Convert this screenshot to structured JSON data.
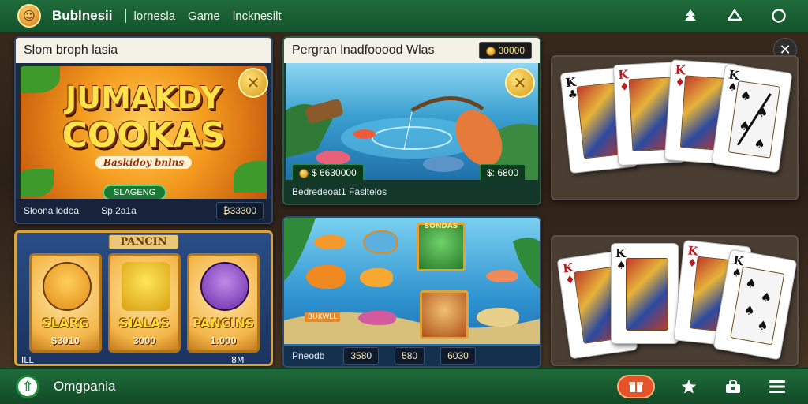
{
  "topbar": {
    "brand": "Bublnesii",
    "nav": [
      "lornesla",
      "Game",
      "lncknesilt"
    ],
    "icons": [
      "tree-icon",
      "home-icon",
      "circle-icon"
    ]
  },
  "card1": {
    "header": "Slom broph lasia",
    "title_line1": "JUMAKDY",
    "title_line2": "COOKAS",
    "subtitle": "Baskidoy bnlns",
    "pill": "SLAGENG",
    "footer_left": "Sloona lodea",
    "footer_mid": "Sp.2a1a",
    "footer_right": "₿33300"
  },
  "card2": {
    "header": "Pergran lnadfooood Wlas",
    "badge_value": "30000",
    "chip_left": "$ 6630000",
    "chip_right": "$: 6800",
    "footer": "Bedredeoat1 Fasltelos"
  },
  "card3": {
    "cards": [
      {
        "rank": "K",
        "suit": "♣",
        "red": false
      },
      {
        "rank": "K",
        "suit": "♦",
        "red": true
      },
      {
        "rank": "K",
        "suit": "♦",
        "red": true
      },
      {
        "rank": "K",
        "suit": "♠",
        "red": false
      }
    ]
  },
  "card4": {
    "banner": "PANCIN",
    "reels": [
      {
        "name": "SLARG",
        "value": "$3010"
      },
      {
        "name": "SIALAS",
        "value": "3000"
      },
      {
        "name": "PANCINS",
        "value": "1:000"
      }
    ],
    "footer_left": "ILL",
    "footer_right": "8M"
  },
  "card5": {
    "portrait_label": "SONDAS",
    "sign_label": "BUKWLL",
    "footer_left": "Pneodb",
    "footer_values": [
      "3580",
      "580",
      "6030"
    ]
  },
  "card6": {
    "cards": [
      {
        "rank": "K",
        "suit": "♦",
        "red": true
      },
      {
        "rank": "K",
        "suit": "♠",
        "red": false
      },
      {
        "rank": "K",
        "suit": "♦",
        "red": true
      },
      {
        "rank": "K",
        "suit": "♠",
        "red": false
      }
    ]
  },
  "bottombar": {
    "title": "Omgpania",
    "icons": [
      "gift-icon",
      "star-icon",
      "bag-icon",
      "menu-icon"
    ]
  }
}
